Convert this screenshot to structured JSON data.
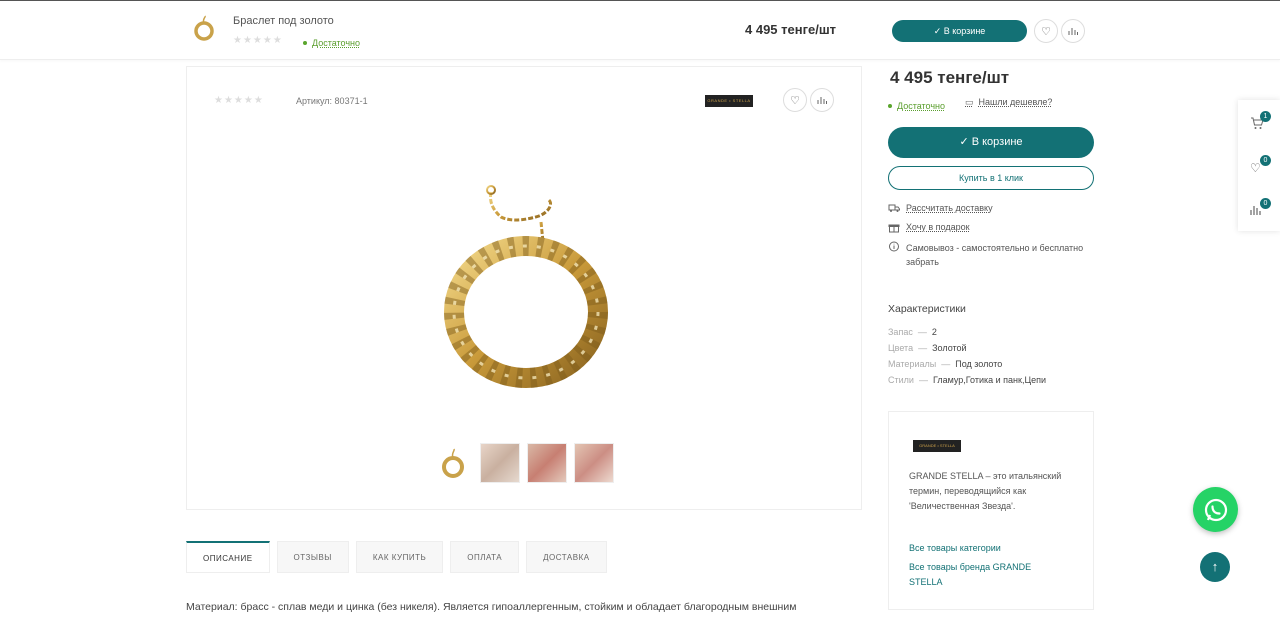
{
  "sticky": {
    "product_name": "Браслет под золото",
    "stars": "★★★★★",
    "availability": "Достаточно",
    "price": "4 495 тенге/шт",
    "cart_button": "✓  В корзине"
  },
  "product": {
    "stars": "★★★★★",
    "sku": "Артикул: 80371-1",
    "brand_logo_text": "GRANDE • STELLA"
  },
  "tabs": [
    {
      "label": "ОПИСАНИЕ"
    },
    {
      "label": "ОТЗЫВЫ"
    },
    {
      "label": "КАК КУПИТЬ"
    },
    {
      "label": "ОПЛАТА"
    },
    {
      "label": "ДОСТАВКА"
    }
  ],
  "description": "Материал: брасс - сплав меди и цинка (без никеля). Является гипоаллергенным, стойким и обладает благородным внешним",
  "buy": {
    "price": "4 495 тенге/шт",
    "availability": "Достаточно",
    "cheaper": "Нашли дешевле?",
    "cart_button": "✓  В корзине",
    "one_click": "Купить в 1 клик",
    "delivery": "Рассчитать доставку",
    "gift": "Хочу в подарок",
    "pickup": "Самовывоз - самостоятельно и бесплатно забрать"
  },
  "characteristics": {
    "title": "Характеристики",
    "rows": [
      {
        "key": "Запас",
        "value": "2"
      },
      {
        "key": "Цвета",
        "value": "Золотой"
      },
      {
        "key": "Материалы",
        "value": "Под золото"
      },
      {
        "key": "Стили",
        "value": "Гламур,Готика и панк,Цепи"
      }
    ]
  },
  "brand": {
    "logo_text": "GRANDE • STELLA",
    "text": "GRANDE STELLA – это итальянский термин, переводящийся как 'Величественная Звезда'.",
    "link_category": "Все товары категории",
    "link_brand": "Все товары бренда GRANDE STELLA"
  },
  "side_panel": {
    "cart_count": "1",
    "favorites_count": "0",
    "compare_count": "0"
  },
  "colors": {
    "accent": "#137175",
    "available": "#5aa52d",
    "whatsapp": "#25d366"
  }
}
